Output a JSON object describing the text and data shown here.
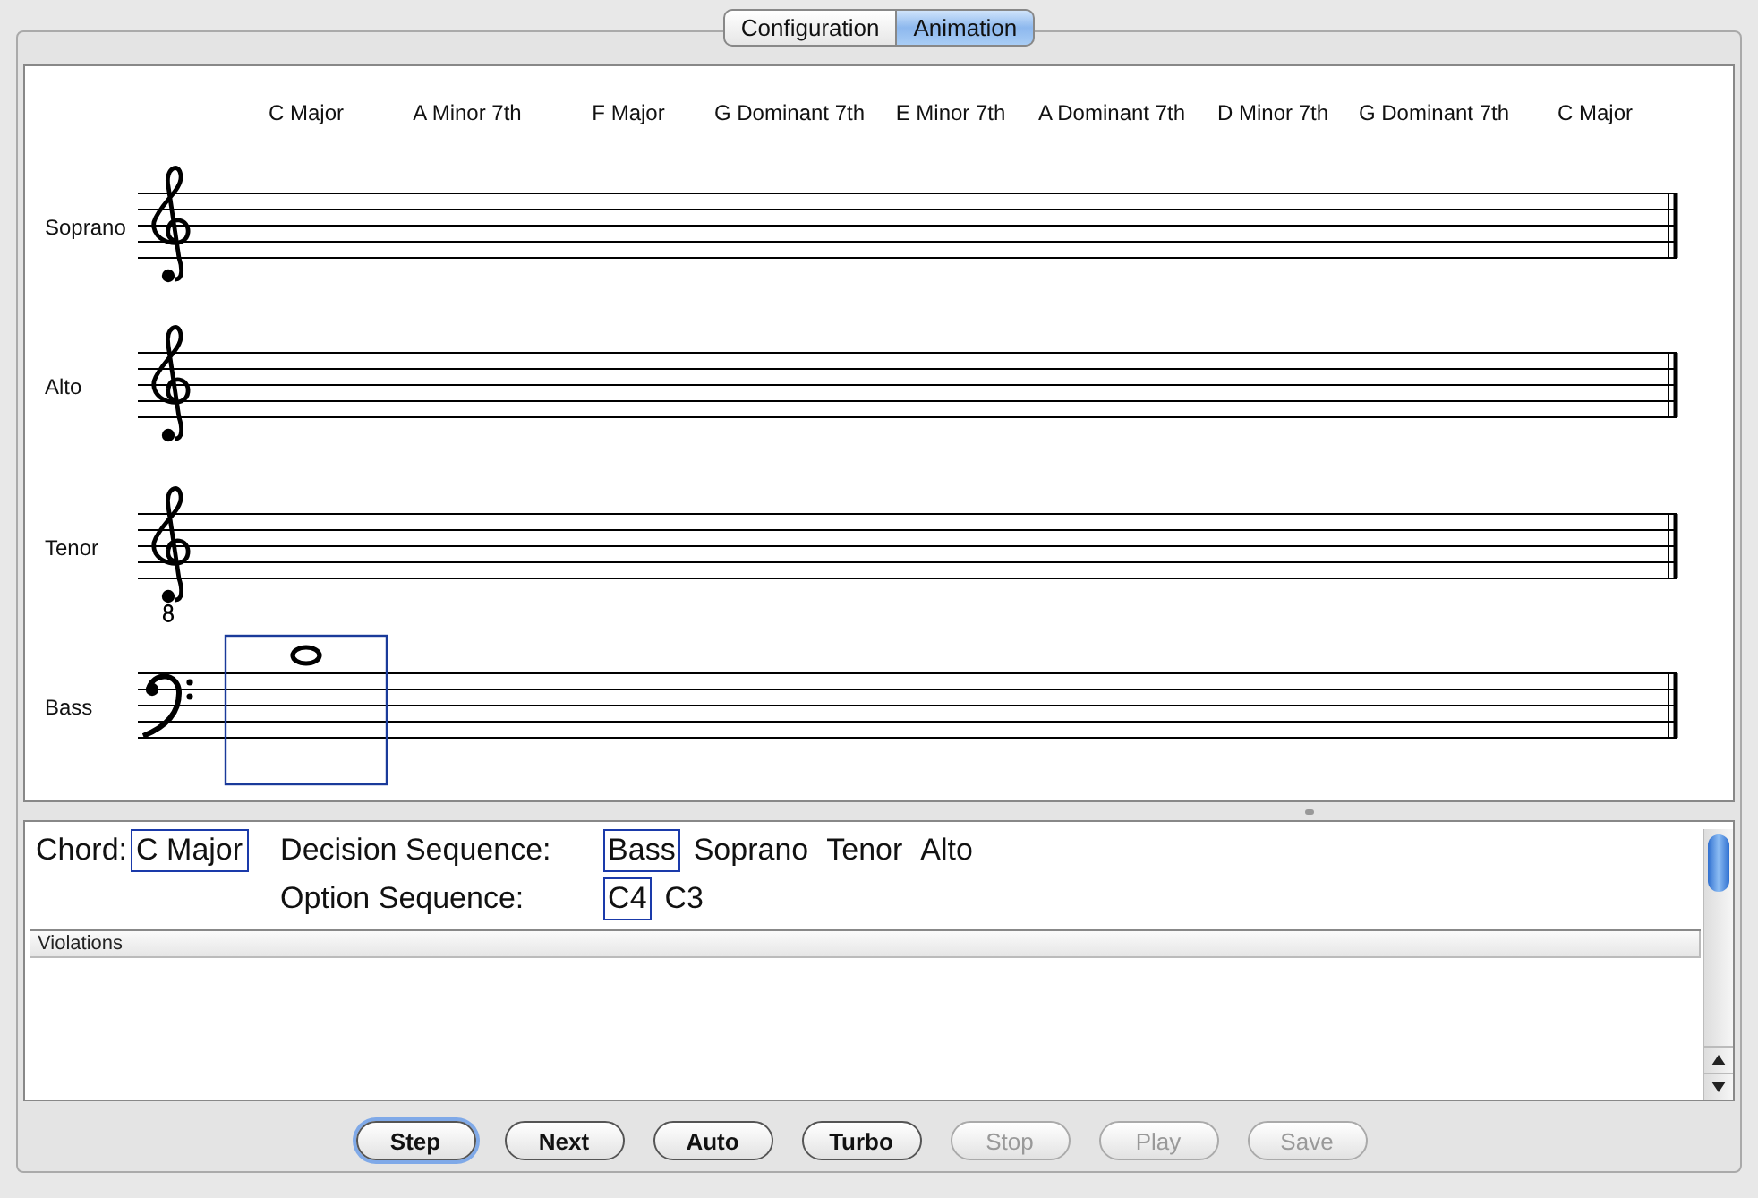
{
  "tabs": [
    {
      "label": "Configuration",
      "selected": false
    },
    {
      "label": "Animation",
      "selected": true
    }
  ],
  "chords": [
    "C Major",
    "A Minor 7th",
    "F Major",
    "G Dominant 7th",
    "E Minor 7th",
    "A Dominant 7th",
    "D Minor 7th",
    "G Dominant 7th",
    "C Major"
  ],
  "voices": [
    {
      "name": "Soprano",
      "kind": "treble"
    },
    {
      "name": "Alto",
      "kind": "treble"
    },
    {
      "name": "Tenor",
      "kind": "treble8"
    },
    {
      "name": "Bass",
      "kind": "bass",
      "notes": [
        {
          "kind": "whole",
          "selected": true
        }
      ]
    }
  ],
  "info": {
    "chord_label": "Chord:",
    "chord_value": "C Major",
    "decision_label": "Decision Sequence:",
    "decision_items": [
      {
        "text": "Bass",
        "selected": true
      },
      {
        "text": "Soprano",
        "selected": false
      },
      {
        "text": "Tenor",
        "selected": false
      },
      {
        "text": "Alto",
        "selected": false
      }
    ],
    "option_label": "Option Sequence:",
    "option_items": [
      {
        "text": "C4",
        "selected": true
      },
      {
        "text": "C3",
        "selected": false
      }
    ],
    "violations_header": "Violations"
  },
  "buttons": [
    {
      "label": "Step",
      "disabled": false,
      "focused": true
    },
    {
      "label": "Next",
      "disabled": false,
      "focused": false
    },
    {
      "label": "Auto",
      "disabled": false,
      "focused": false
    },
    {
      "label": "Turbo",
      "disabled": false,
      "focused": false
    },
    {
      "label": "Stop",
      "disabled": true,
      "focused": false
    },
    {
      "label": "Play",
      "disabled": true,
      "focused": false
    },
    {
      "label": "Save",
      "disabled": true,
      "focused": false
    }
  ]
}
